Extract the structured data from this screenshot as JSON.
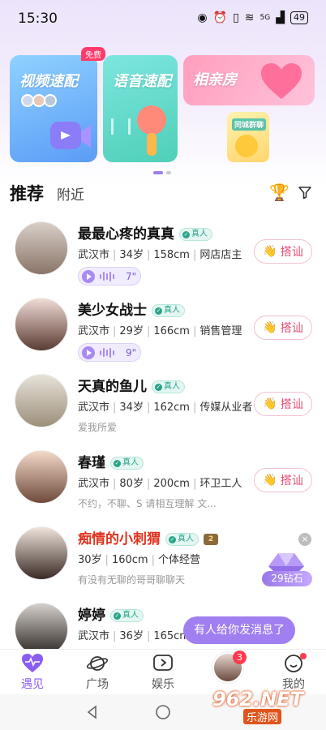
{
  "status_bar": {
    "time": "15:30",
    "network": "5G",
    "battery": "49"
  },
  "banners": {
    "video": {
      "title": "视频速配",
      "tag": "免费"
    },
    "voice": {
      "title": "语音速配"
    },
    "date": {
      "title": "相亲房"
    },
    "city": {
      "title": "同城群聊"
    }
  },
  "tabs": {
    "recommend": "推荐",
    "nearby": "附近"
  },
  "users": [
    {
      "name": "最最心疼的真真",
      "badge": "真人",
      "city": "武汉市",
      "age": "34岁",
      "height": "158cm",
      "job": "网店店主",
      "voice": "7\"",
      "greet": "搭讪"
    },
    {
      "name": "美少女战士",
      "badge": "真人",
      "city": "武汉市",
      "age": "29岁",
      "height": "166cm",
      "job": "销售管理",
      "voice": "9\"",
      "greet": "搭讪"
    },
    {
      "name": "天真的鱼儿",
      "badge": "真人",
      "city": "武汉市",
      "age": "34岁",
      "height": "162cm",
      "job": "传媒从业者",
      "bio": "爱我所爱",
      "greet": "搭讪"
    },
    {
      "name": "春瑾",
      "badge": "真人",
      "city": "武汉市",
      "age": "80岁",
      "height": "200cm",
      "job": "环卫工人",
      "bio": "不约，不聊、S 请相互理解 文...",
      "greet": "搭讪"
    },
    {
      "name": "痴情的小刺猬",
      "badge": "真人",
      "level": "2",
      "age": "30岁",
      "height": "160cm",
      "job": "个体经营",
      "bio": "有没有无聊的哥哥聊聊天"
    },
    {
      "name": "婷婷",
      "badge": "真人",
      "city": "武汉市",
      "age": "36岁",
      "height": "165cm"
    }
  ],
  "floating": {
    "diamond": "29钻石",
    "close": "×",
    "message": "有人给你发消息了"
  },
  "nav": {
    "meet": "遇见",
    "square": "广场",
    "fun": "娱乐",
    "mine": "我的",
    "badge": "3"
  },
  "watermark": {
    "main": "962.NET",
    "sub": "乐游网"
  },
  "colors": {
    "accent": "#8a5ef0",
    "greet": "#e34d74",
    "real": "#2aa38a",
    "highlight_name": "#e0331e"
  }
}
